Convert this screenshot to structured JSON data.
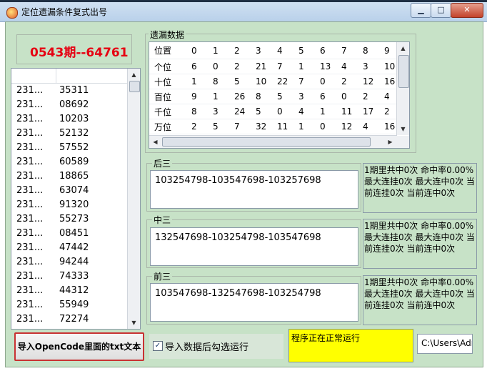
{
  "window": {
    "title": "定位遗漏条件复式出号",
    "min_symbol": "▁",
    "max_symbol": "□",
    "close_symbol": "✕"
  },
  "issue": {
    "label": "0543期--64761",
    "color": "#e60012"
  },
  "history": {
    "rows": [
      [
        "231...",
        "35311"
      ],
      [
        "231...",
        "08692"
      ],
      [
        "231...",
        "10203"
      ],
      [
        "231...",
        "52132"
      ],
      [
        "231...",
        "57552"
      ],
      [
        "231...",
        "60589"
      ],
      [
        "231...",
        "18865"
      ],
      [
        "231...",
        "63074"
      ],
      [
        "231...",
        "91320"
      ],
      [
        "231...",
        "55273"
      ],
      [
        "231...",
        "08451"
      ],
      [
        "231...",
        "47442"
      ],
      [
        "231...",
        "94244"
      ],
      [
        "231...",
        "74333"
      ],
      [
        "231...",
        "44312"
      ],
      [
        "231...",
        "55949"
      ],
      [
        "231...",
        "72274"
      ]
    ]
  },
  "missing": {
    "legend": "遗漏数据",
    "header": [
      "位置",
      "0",
      "1",
      "2",
      "3",
      "4",
      "5",
      "6",
      "7",
      "8",
      "9"
    ],
    "rows": [
      [
        "个位",
        "6",
        "0",
        "2",
        "21",
        "7",
        "1",
        "13",
        "4",
        "3",
        "10"
      ],
      [
        "十位",
        "1",
        "8",
        "5",
        "10",
        "22",
        "7",
        "0",
        "2",
        "12",
        "16"
      ],
      [
        "百位",
        "9",
        "1",
        "26",
        "8",
        "5",
        "3",
        "6",
        "0",
        "2",
        "4"
      ],
      [
        "千位",
        "8",
        "3",
        "24",
        "5",
        "0",
        "4",
        "1",
        "11",
        "17",
        "2"
      ],
      [
        "万位",
        "2",
        "5",
        "7",
        "32",
        "11",
        "1",
        "0",
        "12",
        "4",
        "16"
      ]
    ]
  },
  "groups": [
    {
      "legend": "后三",
      "sequence": "103254798-103547698-103257698",
      "stats": "1期里共中0次 命中率0.00% 最大连挂0次 最大连中0次 当前连挂0次 当前连中0次"
    },
    {
      "legend": "中三",
      "sequence": "132547698-103254798-103547698",
      "stats": "1期里共中0次 命中率0.00% 最大连挂0次 最大连中0次 当前连挂0次 当前连中0次"
    },
    {
      "legend": "前三",
      "sequence": "103547698-132547698-103254798",
      "stats": "1期里共中0次 命中率0.00% 最大连挂0次 最大连中0次 当前连挂0次 当前连中0次"
    }
  ],
  "import_button": "导入OpenCode里面的txt文本",
  "auto_run": {
    "label": "导入数据后勾选运行",
    "checked": true,
    "mark": "✓"
  },
  "status_text": "程序正在正常运行",
  "status_color": "#ffff00",
  "path_text": "C:\\Users\\Administrator",
  "scroll_glyphs": {
    "up": "▲",
    "down": "▼",
    "left": "◀",
    "right": "▶"
  }
}
